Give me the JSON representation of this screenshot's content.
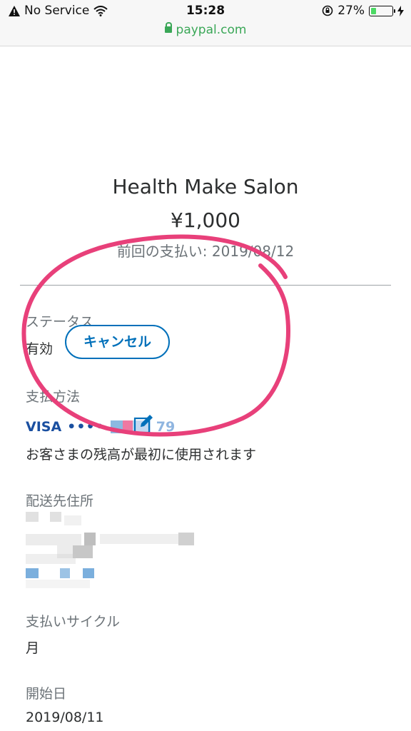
{
  "status_bar": {
    "carrier": "No Service",
    "time": "15:28",
    "battery": "27%",
    "battery_level": 0.27,
    "url": "paypal.com"
  },
  "subscription": {
    "merchant": "Health Make Salon",
    "amount": "¥1,000",
    "last_payment": "前回の支払い: 2019/08/12"
  },
  "status": {
    "label": "ステータス",
    "value": "有効",
    "cancel_label": "キャンセル"
  },
  "payment_method": {
    "label": "支払方法",
    "card_brand": "VISA",
    "card_mask": "••••",
    "card_last": "79",
    "note": "お客さまの残高が最初に使用されます"
  },
  "shipping": {
    "label": "配送先住所"
  },
  "cycle": {
    "label": "支払いサイクル",
    "value": "月"
  },
  "start": {
    "label": "開始日",
    "value": "2019/08/11"
  },
  "colors": {
    "paypal_blue": "#0070ba",
    "annotation_pink": "#e8407a",
    "secure_green": "#3aa757"
  }
}
